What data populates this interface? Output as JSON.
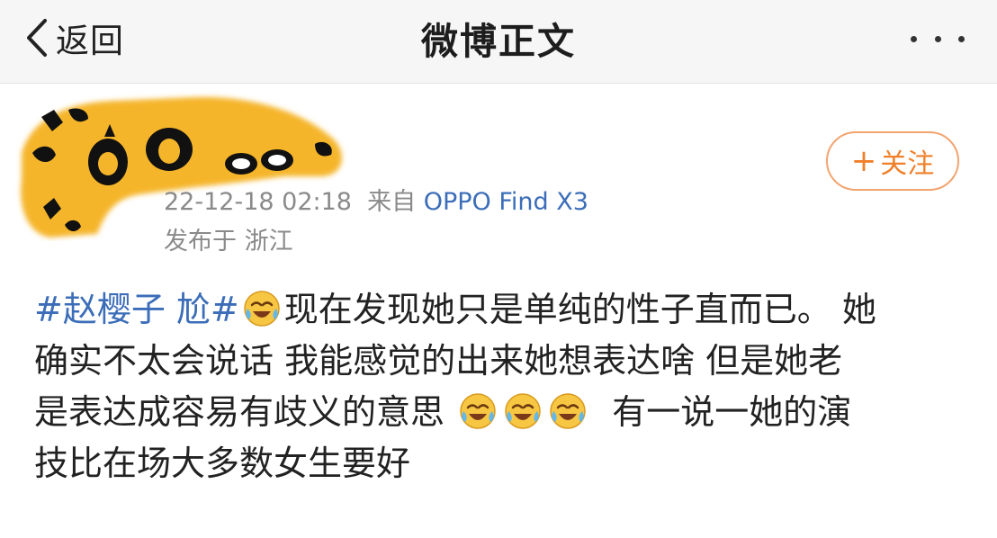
{
  "nav": {
    "back_label": "返回",
    "title": "微博正文",
    "more_icon": "ellipsis-icon"
  },
  "post": {
    "avatar_icon": "blurred-yellow-avatar",
    "timestamp": "22-12-18 02:18",
    "source_prefix": "来自",
    "device": "OPPO Find X3",
    "location": "发布于 浙江",
    "follow_label": "关注",
    "topic": "#赵樱子 尬#",
    "line1_text": "现在发现她只是单纯的性子直而已。 她",
    "line2_text": "确实不太会说话 我能感觉的出来她想表达啥  但是她老",
    "line3_text": "是表达成容易有歧义的意思 ",
    "line3_tail": "  有一说一她的演",
    "line4_text": "技比在场大多数女生要好",
    "emoji_icon": "laugh-cry-emoji-icon"
  },
  "colors": {
    "link_blue": "#3b6db8",
    "follow_orange": "#f0802a",
    "meta_gray": "#8a8a8a",
    "avatar_yellow": "#f5b52a"
  }
}
